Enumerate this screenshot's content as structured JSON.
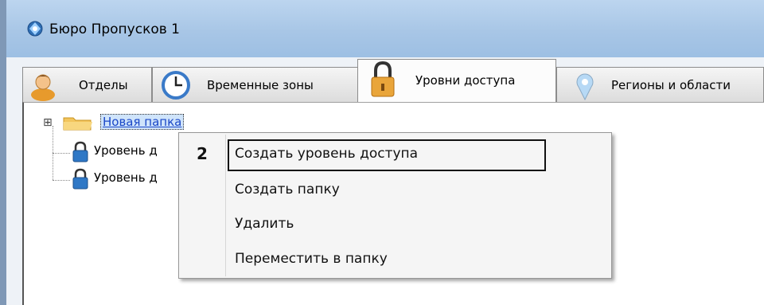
{
  "window": {
    "title": "Бюро Пропусков 1"
  },
  "tabs": [
    {
      "label": "Отделы",
      "icon": "person-icon"
    },
    {
      "label": "Временные зоны",
      "icon": "clock-icon"
    },
    {
      "label": "Уровни доступа",
      "icon": "lock-icon",
      "active": true
    },
    {
      "label": "Регионы и области",
      "icon": "map-pin-icon"
    }
  ],
  "tree": {
    "folder": {
      "label": "Новая папка",
      "expander": "⊞"
    },
    "items": [
      {
        "label": "Уровень д"
      },
      {
        "label": "Уровень д"
      }
    ]
  },
  "context_menu": {
    "items": [
      {
        "label": "Создать уровень доступа"
      },
      {
        "label": "Создать папку"
      },
      {
        "label": "Удалить"
      },
      {
        "label": "Переместить в папку"
      }
    ],
    "callout_number": "2"
  },
  "colors": {
    "titlebar": "#a8c6e6",
    "selection": "#cfe4fb",
    "link": "#1a47c7"
  }
}
